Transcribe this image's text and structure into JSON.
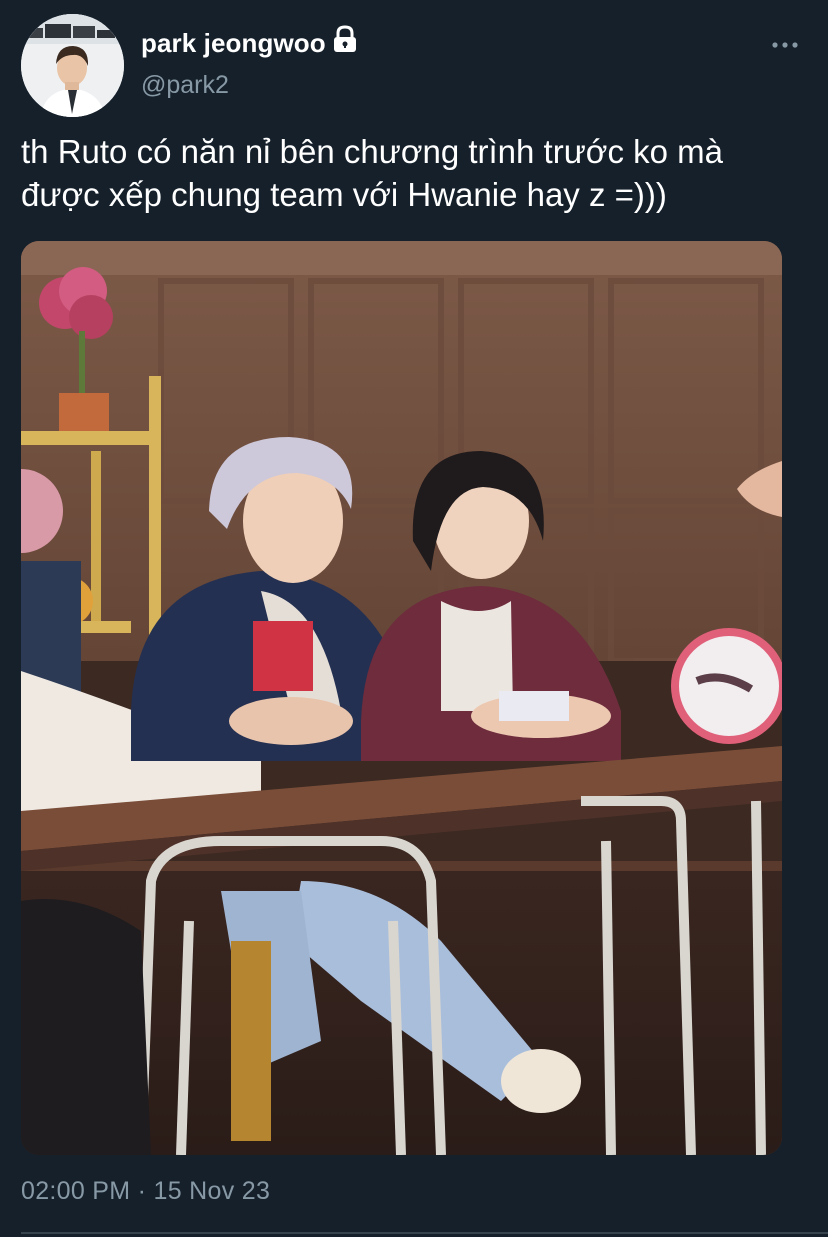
{
  "tweet": {
    "display_name": "park jeongwoo",
    "handle": "@park2",
    "text_line1": "th Ruto có năn nỉ bên chương trình trước ko mà",
    "text_line2": "được xếp chung team với Hwanie hay z =)))",
    "timestamp": "02:00 PM · 15 Nov 23",
    "protected": true
  },
  "icons": {
    "lock": "lock-icon",
    "more": "more-horizontal-icon"
  },
  "colors": {
    "background": "#15202b",
    "primary_text": "#ffffff",
    "secondary_text": "#8899a6",
    "divider": "#38444d"
  }
}
